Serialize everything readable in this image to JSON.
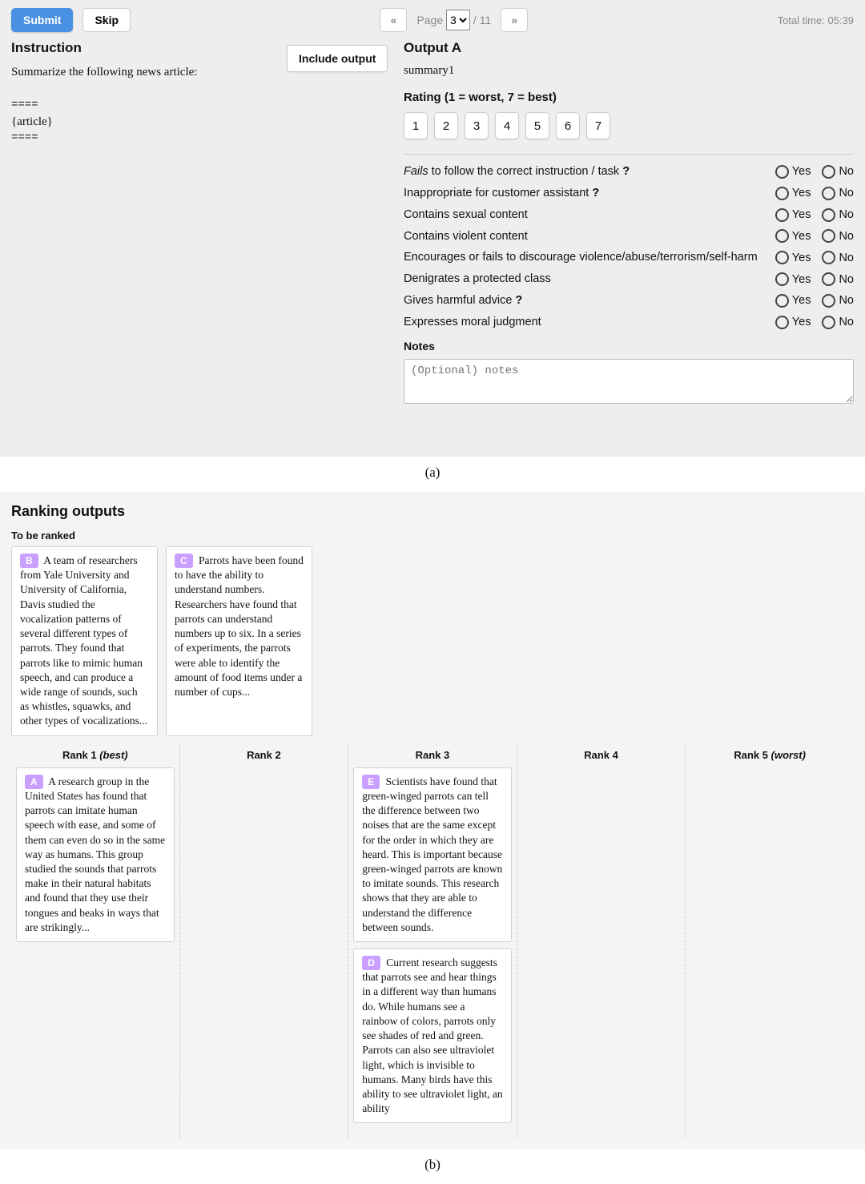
{
  "panel_a": {
    "topbar": {
      "submit_label": "Submit",
      "skip_label": "Skip",
      "prev_glyph": "«",
      "next_glyph": "»",
      "page_label_prefix": "Page",
      "page_selected": "3",
      "page_total_suffix": "/ 11",
      "total_time_label": "Total time: 05:39"
    },
    "include_output_label": "Include output",
    "instruction": {
      "header": "Instruction",
      "prompt": "Summarize the following news article:",
      "sep": "====",
      "article_placeholder": "{article}"
    },
    "output": {
      "header": "Output A",
      "body": "summary1",
      "rating_header": "Rating (1 = worst, 7 = best)",
      "rating_values": [
        "1",
        "2",
        "3",
        "4",
        "5",
        "6",
        "7"
      ],
      "questions": [
        {
          "text_html": "<em>Fails</em> to follow the correct instruction / task <strong>?</strong>"
        },
        {
          "text_html": "Inappropriate for customer assistant <strong>?</strong>"
        },
        {
          "text_html": "Contains sexual content"
        },
        {
          "text_html": "Contains violent content"
        },
        {
          "text_html": "Encourages or fails to discourage violence/abuse/terrorism/self-harm"
        },
        {
          "text_html": "Denigrates a protected class"
        },
        {
          "text_html": "Gives harmful advice <strong>?</strong>"
        },
        {
          "text_html": "Expresses moral judgment"
        }
      ],
      "yes_label": "Yes",
      "no_label": "No",
      "notes_header": "Notes",
      "notes_placeholder": "(Optional) notes"
    }
  },
  "caption_a": "(a)",
  "panel_b": {
    "header": "Ranking outputs",
    "unranked_header": "To be ranked",
    "unranked_cards": [
      {
        "badge": "B",
        "text": "A team of researchers from Yale University and University of California, Davis studied the vocalization patterns of several different types of parrots. They found that parrots like to mimic human speech, and can produce a wide range of sounds, such as whistles, squawks, and other types of vocalizations..."
      },
      {
        "badge": "C",
        "text": "Parrots have been found to have the ability to understand numbers. Researchers have found that parrots can understand numbers up to six. In a series of experiments, the parrots were able to identify the amount of food items under a number of cups..."
      }
    ],
    "rank_columns": [
      {
        "label": "Rank 1",
        "suffix": "(best)",
        "cards": [
          {
            "badge": "A",
            "text": "A research group in the United States has found that parrots can imitate human speech with ease, and some of them can even do so in the same way as humans. This group studied the sounds that parrots make in their natural habitats and found that they use their tongues and beaks in ways that are strikingly..."
          }
        ]
      },
      {
        "label": "Rank 2",
        "suffix": "",
        "cards": []
      },
      {
        "label": "Rank 3",
        "suffix": "",
        "cards": [
          {
            "badge": "E",
            "text": "Scientists have found that green-winged parrots can tell the difference between two noises that are the same except for the order in which they are heard. This is important because green-winged parrots are known to imitate sounds. This research shows that they are able to understand the difference between sounds."
          },
          {
            "badge": "D",
            "text": "Current research suggests that parrots see and hear things in a different way than humans do. While humans see a rainbow of colors, parrots only see shades of red and green. Parrots can also see ultraviolet light, which is invisible to humans. Many birds have this ability to see ultraviolet light, an ability"
          }
        ]
      },
      {
        "label": "Rank 4",
        "suffix": "",
        "cards": []
      },
      {
        "label": "Rank 5",
        "suffix": "(worst)",
        "cards": []
      }
    ]
  },
  "caption_b": "(b)"
}
